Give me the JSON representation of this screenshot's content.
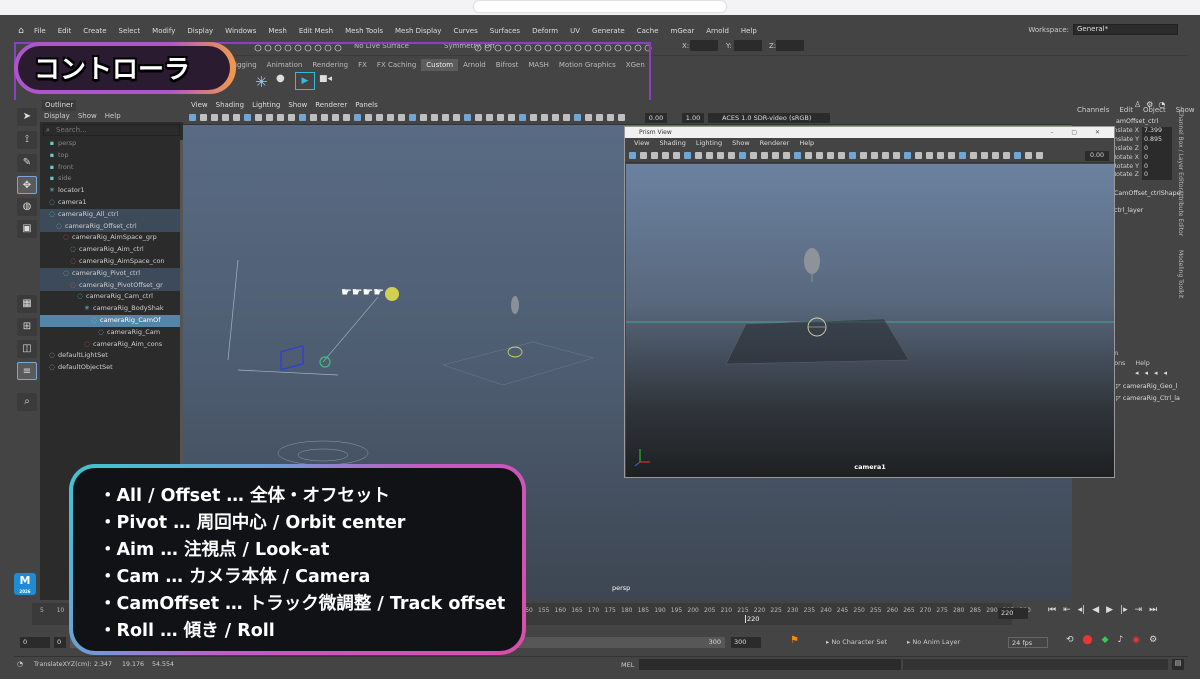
{
  "window": {
    "menu": [
      "File",
      "Edit",
      "Create",
      "Select",
      "Modify",
      "Display",
      "Windows",
      "Mesh",
      "Edit Mesh",
      "Mesh Tools",
      "Mesh Display",
      "Curves",
      "Surfaces",
      "Deform",
      "UV",
      "Generate",
      "Cache",
      "mGear",
      "Arnold",
      "Help"
    ],
    "workspace_label": "Workspace:",
    "workspace_value": "General*"
  },
  "statusline": {
    "live_surface": "No Live Surface",
    "symmetry": "Symmetry: Off",
    "x_label": "X:",
    "y_label": "Y:",
    "z_label": "Z:"
  },
  "shelf": {
    "tabs": [
      "igging",
      "Animation",
      "Rendering",
      "FX",
      "FX Caching",
      "Custom",
      "Arnold",
      "Bifrost",
      "MASH",
      "Motion Graphics",
      "XGen"
    ],
    "active_tab": "Custom"
  },
  "overlay_title": "コントローラ",
  "outliner": {
    "title": "Outliner",
    "menu": [
      "Display",
      "Show",
      "Help"
    ],
    "search_placeholder": "Search...",
    "rows": [
      {
        "label": "persp",
        "indent": 0,
        "state": "dim"
      },
      {
        "label": "top",
        "indent": 0,
        "state": "dim"
      },
      {
        "label": "front",
        "indent": 0,
        "state": "dim"
      },
      {
        "label": "side",
        "indent": 0,
        "state": "dim"
      },
      {
        "label": "locator1",
        "indent": 0,
        "state": ""
      },
      {
        "label": "camera1",
        "indent": 0,
        "state": ""
      },
      {
        "label": "cameraRig_All_ctrl",
        "indent": 0,
        "state": "hl"
      },
      {
        "label": "cameraRig_Offset_ctrl",
        "indent": 1,
        "state": "hl"
      },
      {
        "label": "cameraRig_AimSpace_grp",
        "indent": 2,
        "state": ""
      },
      {
        "label": "cameraRig_Aim_ctrl",
        "indent": 3,
        "state": ""
      },
      {
        "label": "cameraRig_AimSpace_con",
        "indent": 3,
        "state": ""
      },
      {
        "label": "cameraRig_Pivot_ctrl",
        "indent": 2,
        "state": "hl"
      },
      {
        "label": "cameraRig_PivotOffset_gr",
        "indent": 3,
        "state": "hl"
      },
      {
        "label": "cameraRig_Cam_ctrl",
        "indent": 4,
        "state": ""
      },
      {
        "label": "cameraRig_BodyShak",
        "indent": 5,
        "state": ""
      },
      {
        "label": "cameraRig_CamOf",
        "indent": 6,
        "state": "sel"
      },
      {
        "label": "cameraRig_Cam",
        "indent": 7,
        "state": ""
      },
      {
        "label": "cameraRig_Aim_cons",
        "indent": 5,
        "state": ""
      },
      {
        "label": "defaultLightSet",
        "indent": 0,
        "state": ""
      },
      {
        "label": "defaultObjectSet",
        "indent": 0,
        "state": ""
      }
    ]
  },
  "viewport": {
    "menu": [
      "View",
      "Shading",
      "Lighting",
      "Show",
      "Renderer",
      "Panels"
    ],
    "num1": "0.00",
    "num2": "1.00",
    "colorspace": "ACES 1.0 SDR-video (sRGB)",
    "camera_label": "persp"
  },
  "prism": {
    "title": "Prism View",
    "menu": [
      "View",
      "Shading",
      "Lighting",
      "Show",
      "Renderer",
      "Help"
    ],
    "num": "0.00",
    "camera_label": "camera1"
  },
  "channelbox": {
    "tabs": [
      "Channels",
      "Edit",
      "Object",
      "Show"
    ],
    "object": "amOffset_ctrl",
    "attrs": [
      {
        "k": "anslate X",
        "v": "7.399"
      },
      {
        "k": "anslate Y",
        "v": "0.895"
      },
      {
        "k": "anslate Z",
        "v": "0"
      },
      {
        "k": "Rotate X",
        "v": "0"
      },
      {
        "k": "Rotate Y",
        "v": "0"
      },
      {
        "k": "Rotate Z",
        "v": "0"
      }
    ],
    "shape": "CamOffset_ctrlShape",
    "layer": "ctrl_layer",
    "side_tabs": [
      "Channel Box / Layer Editor",
      "Attribute Editor",
      "Modeling Toolkit"
    ]
  },
  "layers": {
    "menu_left": "m",
    "menu": [
      "tions",
      "Help"
    ],
    "items": [
      "cameraRig_Geo_l",
      "cameraRig_Ctrl_la"
    ]
  },
  "timeline": {
    "ticks": [
      "5",
      "10",
      "15",
      "20",
      "25",
      "30",
      "35",
      "40",
      "45",
      "50",
      "55",
      "60",
      "65",
      "70",
      "75",
      "80",
      "85",
      "90",
      "95",
      "100",
      "105",
      "110",
      "115",
      "120",
      "125",
      "130",
      "135",
      "140",
      "145",
      "150",
      "155",
      "160",
      "165",
      "170",
      "175",
      "180",
      "185",
      "190",
      "195",
      "200",
      "205",
      "210",
      "215",
      "220",
      "225",
      "230",
      "235",
      "240",
      "245",
      "250",
      "255",
      "260",
      "265",
      "270",
      "275",
      "280",
      "285",
      "290",
      "295",
      "300"
    ],
    "current_frame": "220",
    "end_field": "220",
    "start": "0",
    "start2": "0",
    "range_end": "300",
    "range_end2": "300",
    "char_set": "No Character Set",
    "anim_layer": "No Anim Layer",
    "fps": "24 fps"
  },
  "cmdline": {
    "attr": "TranslateXYZ(cm):",
    "x": "2.347",
    "y": "19.176",
    "z": "54.554",
    "mel": "MEL"
  },
  "maya_badge": {
    "letter": "M",
    "sub": "2026"
  },
  "legend": [
    "・All / Offset … 全体・オフセット",
    "・Pivot … 周回中心 / Orbit center",
    "・Aim … 注視点 / Look-at",
    "・Cam … カメラ本体 / Camera",
    "・CamOffset … トラック微調整 / Track offset",
    "・Roll … 傾き / Roll"
  ],
  "colors": {
    "accent_purple": "#8a3fc4",
    "selection": "#5285a6",
    "legend_border_start": "#3fc6cf",
    "legend_border_end": "#d84fa8"
  }
}
